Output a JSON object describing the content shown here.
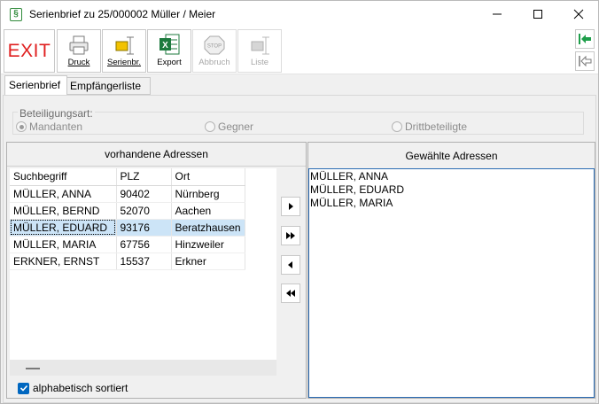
{
  "window": {
    "title": "Serienbrief zu 25/000002 Müller / Meier",
    "app_icon_glyph": "§"
  },
  "toolbar": {
    "exit_label": "EXIT",
    "druck_label": "Druck",
    "serienbr_label": "Serienbr.",
    "export_label": "Export",
    "abbruch_label": "Abbruch",
    "liste_label": "Liste",
    "stop_text": "STOP"
  },
  "tabs": {
    "serienbrief": "Serienbrief",
    "empfaengerliste": "Empfängerliste"
  },
  "beteiligung": {
    "title": "Beteiligungsart:",
    "options": [
      "Mandanten",
      "Gegner",
      "Drittbeteiligte"
    ],
    "selected": "Mandanten"
  },
  "left": {
    "header": "vorhandene Adressen",
    "columns": [
      "Suchbegriff",
      "PLZ",
      "Ort"
    ],
    "rows": [
      [
        "MÜLLER, ANNA",
        "90402",
        "Nürnberg"
      ],
      [
        "MÜLLER, BERND",
        "52070",
        "Aachen"
      ],
      [
        "MÜLLER, EDUARD",
        "93176",
        "Beratzhausen"
      ],
      [
        "MÜLLER, MARIA",
        "67756",
        "Hinzweiler"
      ],
      [
        "ERKNER, ERNST",
        "15537",
        "Erkner"
      ]
    ],
    "selected_row": 2,
    "sort_label": "alphabetisch sortiert",
    "sort_checked": true
  },
  "right": {
    "header": "Gewählte Adressen",
    "items": [
      "MÜLLER, ANNA",
      "MÜLLER, EDUARD",
      "MÜLLER, MARIA"
    ]
  },
  "colors": {
    "exit_red": "#e02020",
    "excel_green": "#1d7a3e",
    "nav_green": "#1e9e4a",
    "selection": "#cce4f7",
    "focus_border": "#2b6cb3"
  }
}
